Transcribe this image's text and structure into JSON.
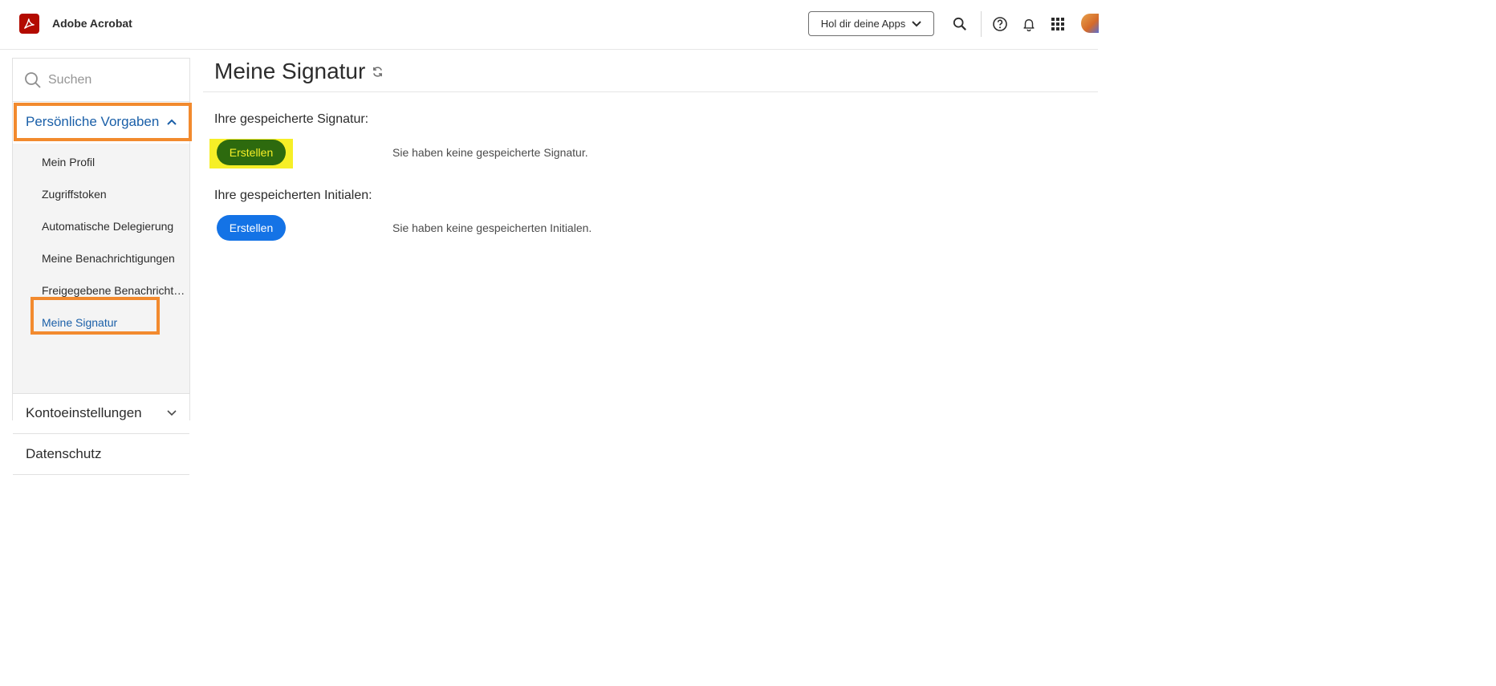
{
  "app": {
    "title": "Adobe Acrobat"
  },
  "header": {
    "apps_button_label": "Hol dir deine Apps",
    "icons": [
      "search-icon",
      "help-icon",
      "bell-icon",
      "app-grid-icon",
      "avatar"
    ]
  },
  "sidebar": {
    "search_placeholder": "Suchen",
    "sections": [
      {
        "label": "Persönliche Vorgaben",
        "expanded": true,
        "items": [
          {
            "label": "Mein Profil"
          },
          {
            "label": "Zugriffstoken"
          },
          {
            "label": "Automatische Delegierung"
          },
          {
            "label": "Meine Benachrichtigungen"
          },
          {
            "label": "Freigegebene Benachrichtig..."
          },
          {
            "label": "Meine Signatur",
            "active": true
          }
        ]
      },
      {
        "label": "Kontoeinstellungen",
        "expanded": false
      },
      {
        "label": "Datenschutz"
      }
    ]
  },
  "main": {
    "title": "Meine Signatur",
    "signature": {
      "label": "Ihre gespeicherte Signatur:",
      "button": "Erstellen",
      "note": "Sie haben keine gespeicherte Signatur."
    },
    "initials": {
      "label": "Ihre gespeicherten Initialen:",
      "button": "Erstellen",
      "note": "Sie haben keine gespeicherten Initialen."
    }
  },
  "colors": {
    "accent_blue": "#1473e6",
    "link_blue": "#1a5fa8",
    "brand_red": "#b30b00",
    "highlight_orange": "#f28a2e",
    "highlight_yellow": "#f6ef27"
  }
}
